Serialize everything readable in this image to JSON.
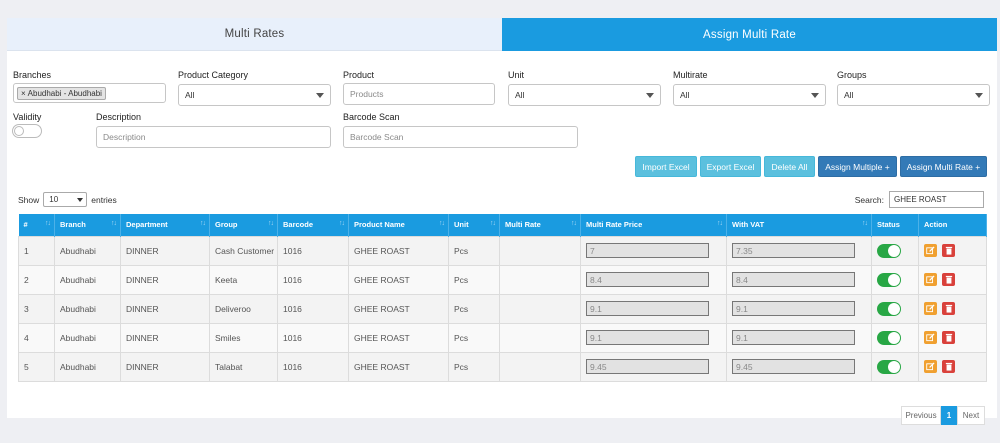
{
  "tabs": [
    {
      "label": "Multi Rates",
      "active": false
    },
    {
      "label": "Assign Multi Rate",
      "active": true
    }
  ],
  "filters": {
    "branches": {
      "label": "Branches",
      "tag": "Abudhabi - Abudhabi",
      "tag_remove": "×"
    },
    "product_category": {
      "label": "Product Category",
      "value": "All"
    },
    "product": {
      "label": "Product",
      "placeholder": "Products"
    },
    "unit": {
      "label": "Unit",
      "value": "All"
    },
    "multirate": {
      "label": "Multirate",
      "value": "All"
    },
    "groups": {
      "label": "Groups",
      "value": "All"
    },
    "validity": {
      "label": "Validity"
    },
    "description": {
      "label": "Description",
      "placeholder": "Description"
    },
    "barcode_scan": {
      "label": "Barcode Scan",
      "placeholder": "Barcode Scan"
    }
  },
  "buttons": {
    "import_excel": "Import Excel",
    "export_excel": "Export Excel",
    "delete_all": "Delete All",
    "assign_multiple": "Assign Multiple +",
    "assign_multi_rate": "Assign Multi Rate +"
  },
  "table_controls": {
    "show_label": "Show",
    "entries_value": "10",
    "entries_label": "entries",
    "search_label": "Search:",
    "search_value": "GHEE ROAST"
  },
  "table": {
    "columns": [
      "#",
      "Branch",
      "Department",
      "Group",
      "Barcode",
      "Product Name",
      "Unit",
      "Multi Rate",
      "Multi Rate Price",
      "With VAT",
      "Status",
      "Action"
    ],
    "rows": [
      {
        "num": "1",
        "branch": "Abudhabi",
        "department": "DINNER",
        "group": "Cash Customer",
        "barcode": "1016",
        "product": "GHEE ROAST",
        "unit": "Pcs",
        "multi_rate": "",
        "price": "7",
        "with_vat": "7.35",
        "status": true
      },
      {
        "num": "2",
        "branch": "Abudhabi",
        "department": "DINNER",
        "group": "Keeta",
        "barcode": "1016",
        "product": "GHEE ROAST",
        "unit": "Pcs",
        "multi_rate": "",
        "price": "8.4",
        "with_vat": "8.4",
        "status": true
      },
      {
        "num": "3",
        "branch": "Abudhabi",
        "department": "DINNER",
        "group": "Deliveroo",
        "barcode": "1016",
        "product": "GHEE ROAST",
        "unit": "Pcs",
        "multi_rate": "",
        "price": "9.1",
        "with_vat": "9.1",
        "status": true
      },
      {
        "num": "4",
        "branch": "Abudhabi",
        "department": "DINNER",
        "group": "Smiles",
        "barcode": "1016",
        "product": "GHEE ROAST",
        "unit": "Pcs",
        "multi_rate": "",
        "price": "9.1",
        "with_vat": "9.1",
        "status": true
      },
      {
        "num": "5",
        "branch": "Abudhabi",
        "department": "DINNER",
        "group": "Talabat",
        "barcode": "1016",
        "product": "GHEE ROAST",
        "unit": "Pcs",
        "multi_rate": "",
        "price": "9.45",
        "with_vat": "9.45",
        "status": true
      }
    ]
  },
  "pagination": {
    "previous": "Previous",
    "current": "1",
    "next": "Next"
  },
  "colors": {
    "accent": "#1a9be0",
    "tab_inactive": "#e8f0fb",
    "btn_light": "#5bc0de",
    "btn_dark": "#337ab7",
    "toggle_on": "#28a745",
    "edit": "#f0a030",
    "delete": "#d9413b"
  },
  "icons": {
    "sort": "sort-arrows-icon",
    "edit": "pencil-square-icon",
    "delete": "trash-icon",
    "dropdown": "chevron-down-icon"
  }
}
